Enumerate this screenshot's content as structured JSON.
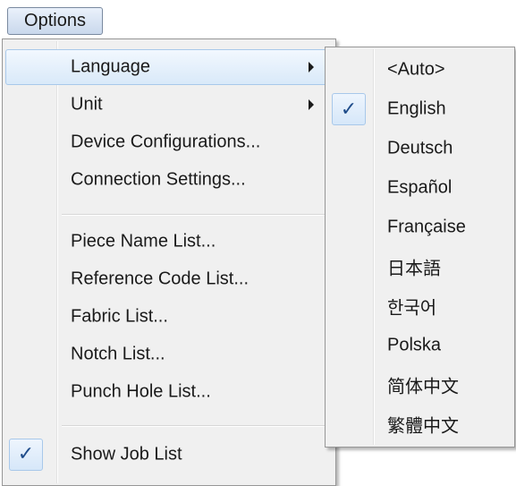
{
  "menubar": {
    "options_label": "Options"
  },
  "main_menu": {
    "items": [
      {
        "label": "Language",
        "has_submenu": true,
        "highlighted": true
      },
      {
        "label": "Unit",
        "has_submenu": true
      },
      {
        "label": "Device Configurations..."
      },
      {
        "label": "Connection Settings..."
      },
      {
        "label": "Piece Name List..."
      },
      {
        "label": "Reference Code List..."
      },
      {
        "label": "Fabric List..."
      },
      {
        "label": "Notch List..."
      },
      {
        "label": "Punch Hole List..."
      },
      {
        "label": "Show Job List",
        "checked": true
      }
    ]
  },
  "language_submenu": {
    "items": [
      {
        "label": "<Auto>"
      },
      {
        "label": "English",
        "checked": true
      },
      {
        "label": "Deutsch"
      },
      {
        "label": "Español"
      },
      {
        "label": "Française"
      },
      {
        "label": "日本語"
      },
      {
        "label": "한국어"
      },
      {
        "label": "Polska"
      },
      {
        "label": "简体中文"
      },
      {
        "label": "繁體中文"
      }
    ]
  },
  "icons": {
    "check": "✓",
    "submenu_arrow": "submenu-arrow-icon"
  },
  "colors": {
    "highlight_border": "#a8c8ea",
    "check_color": "#1f4c8a"
  }
}
